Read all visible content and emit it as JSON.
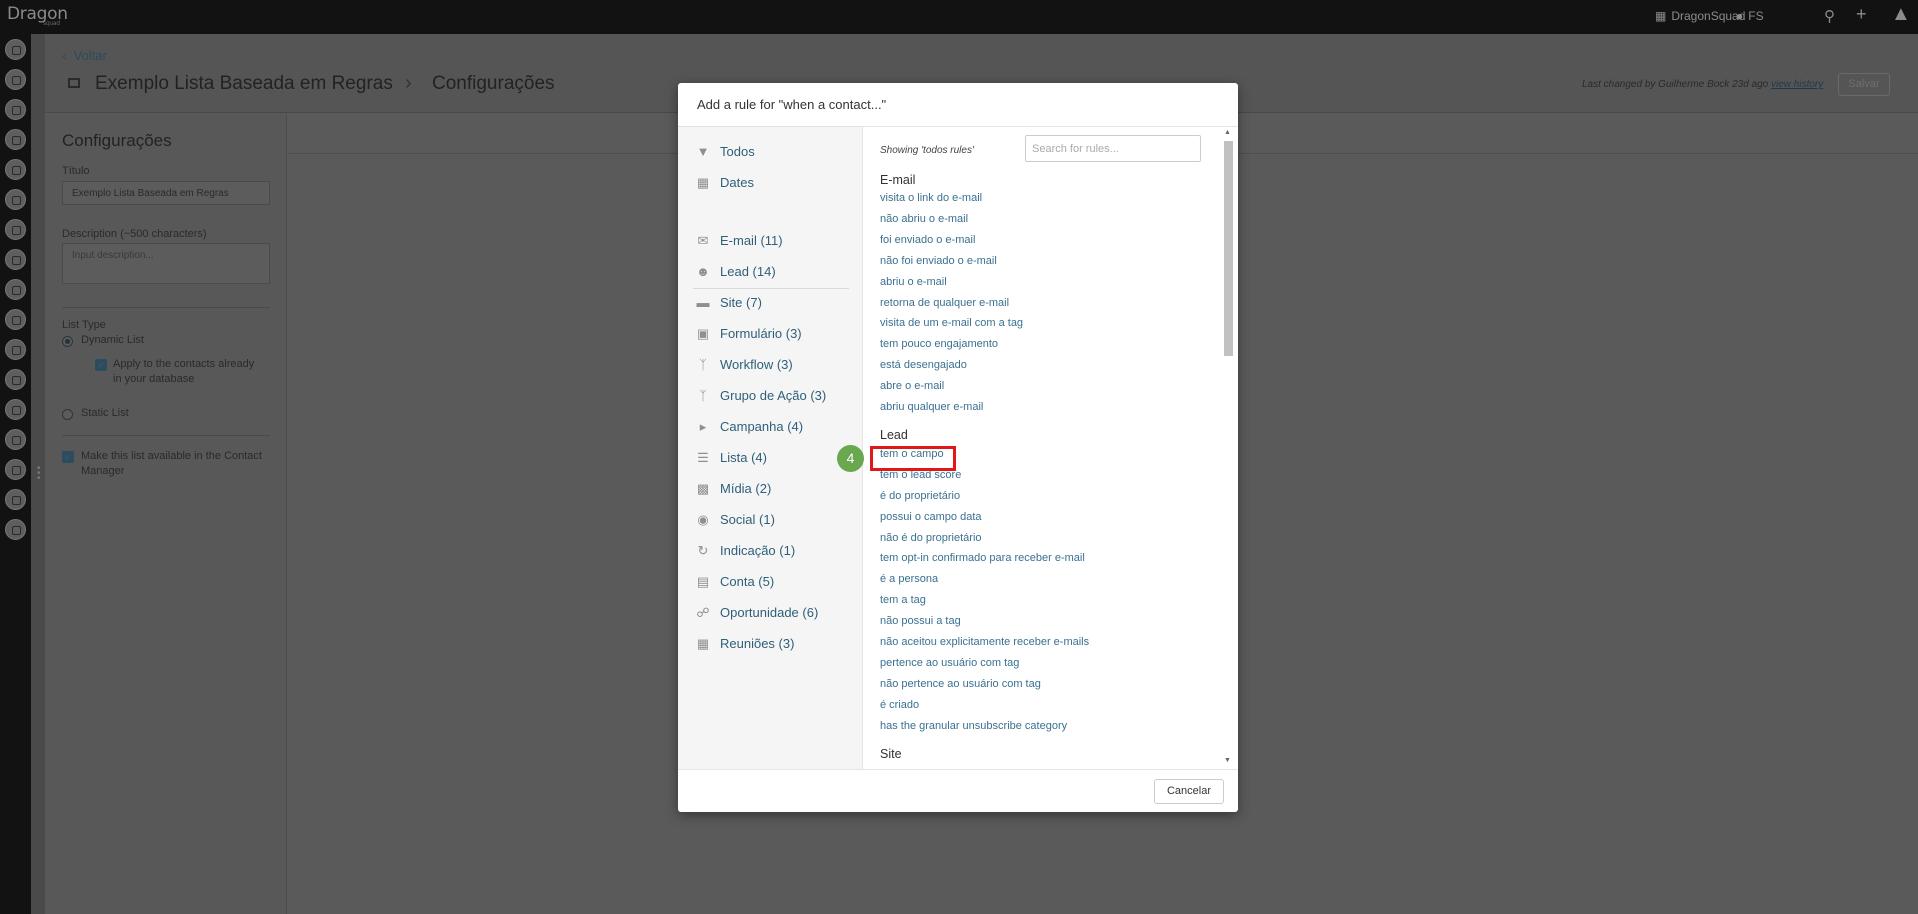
{
  "topbar": {
    "logo": "Dragon",
    "logo_sub": "squad",
    "workspace": "DragonSquad",
    "user_initials": "FS"
  },
  "page": {
    "back_label": "Voltar",
    "breadcrumb_title": "Exemplo Lista Baseada em Regras",
    "breadcrumb_current": "Configurações",
    "last_changed_prefix": "Last changed by Guilherme Bock 23d ago",
    "view_history": "view history",
    "save_label": "Salvar"
  },
  "settings": {
    "title": "Configurações",
    "title_label": "Título",
    "title_value": "Exemplo Lista Baseada em Regras",
    "description_label": "Description (~500 characters)",
    "description_placeholder": "Input description...",
    "list_type_label": "List Type",
    "dynamic_list": "Dynamic List",
    "apply_existing_line1": "Apply to the contacts already",
    "apply_existing_line2": "in your database",
    "static_list": "Static List",
    "available_line1": "Make this list available in the Contact",
    "available_line2": "Manager"
  },
  "modal": {
    "title": "Add a rule for \"when a contact...\"",
    "showing": "Showing 'todos rules'",
    "search_placeholder": "Search for rules...",
    "cancel_label": "Cancelar",
    "filters": [
      {
        "label": "Todos",
        "icon": "filter-icon"
      },
      {
        "label": "Dates",
        "icon": "calendar-icon"
      }
    ],
    "categories": [
      {
        "label": "E-mail (11)",
        "icon": "envelope-icon"
      },
      {
        "label": "Lead (14)",
        "icon": "user-icon"
      },
      {
        "label": "Site (7)",
        "icon": "browser-icon"
      },
      {
        "label": "Formulário (3)",
        "icon": "clipboard-icon"
      },
      {
        "label": "Workflow (3)",
        "icon": "branch-icon"
      },
      {
        "label": "Grupo de Ação (3)",
        "icon": "branch-icon"
      },
      {
        "label": "Campanha (4)",
        "icon": "megaphone-icon"
      },
      {
        "label": "Lista (4)",
        "icon": "list-icon"
      },
      {
        "label": "Mídia (2)",
        "icon": "film-icon"
      },
      {
        "label": "Social (1)",
        "icon": "comments-icon"
      },
      {
        "label": "Indicação (1)",
        "icon": "refresh-icon"
      },
      {
        "label": "Conta (5)",
        "icon": "briefcase-icon"
      },
      {
        "label": "Oportunidade (6)",
        "icon": "handshake-icon"
      },
      {
        "label": "Reuniões (3)",
        "icon": "calendar-icon"
      }
    ],
    "sections": {
      "email": {
        "title": "E-mail",
        "rules": [
          "visita o link do e-mail",
          "não abriu o e-mail",
          "foi enviado o e-mail",
          "não foi enviado o e-mail",
          "abriu o e-mail",
          "retorna de qualquer e-mail",
          "visita de um e-mail com a tag",
          "tem pouco engajamento",
          "está desengajado",
          "abre o e-mail",
          "abriu qualquer e-mail"
        ]
      },
      "lead": {
        "title": "Lead",
        "rules": [
          "tem o campo",
          "tem o lead score",
          "é do proprietário",
          "possui o campo data",
          "não é do proprietário",
          "tem opt-in confirmado para receber e-mail",
          "é a persona",
          "tem a tag",
          "não possui a tag",
          "não aceitou explicitamente receber e-mails",
          "pertence ao usuário com tag",
          "não pertence ao usuário com tag",
          "é criado",
          "has the granular unsubscribe category"
        ]
      },
      "site": {
        "title": "Site"
      }
    }
  },
  "annotation": {
    "step": "4",
    "color": "#e01818",
    "badge_color": "#6aa84f"
  }
}
